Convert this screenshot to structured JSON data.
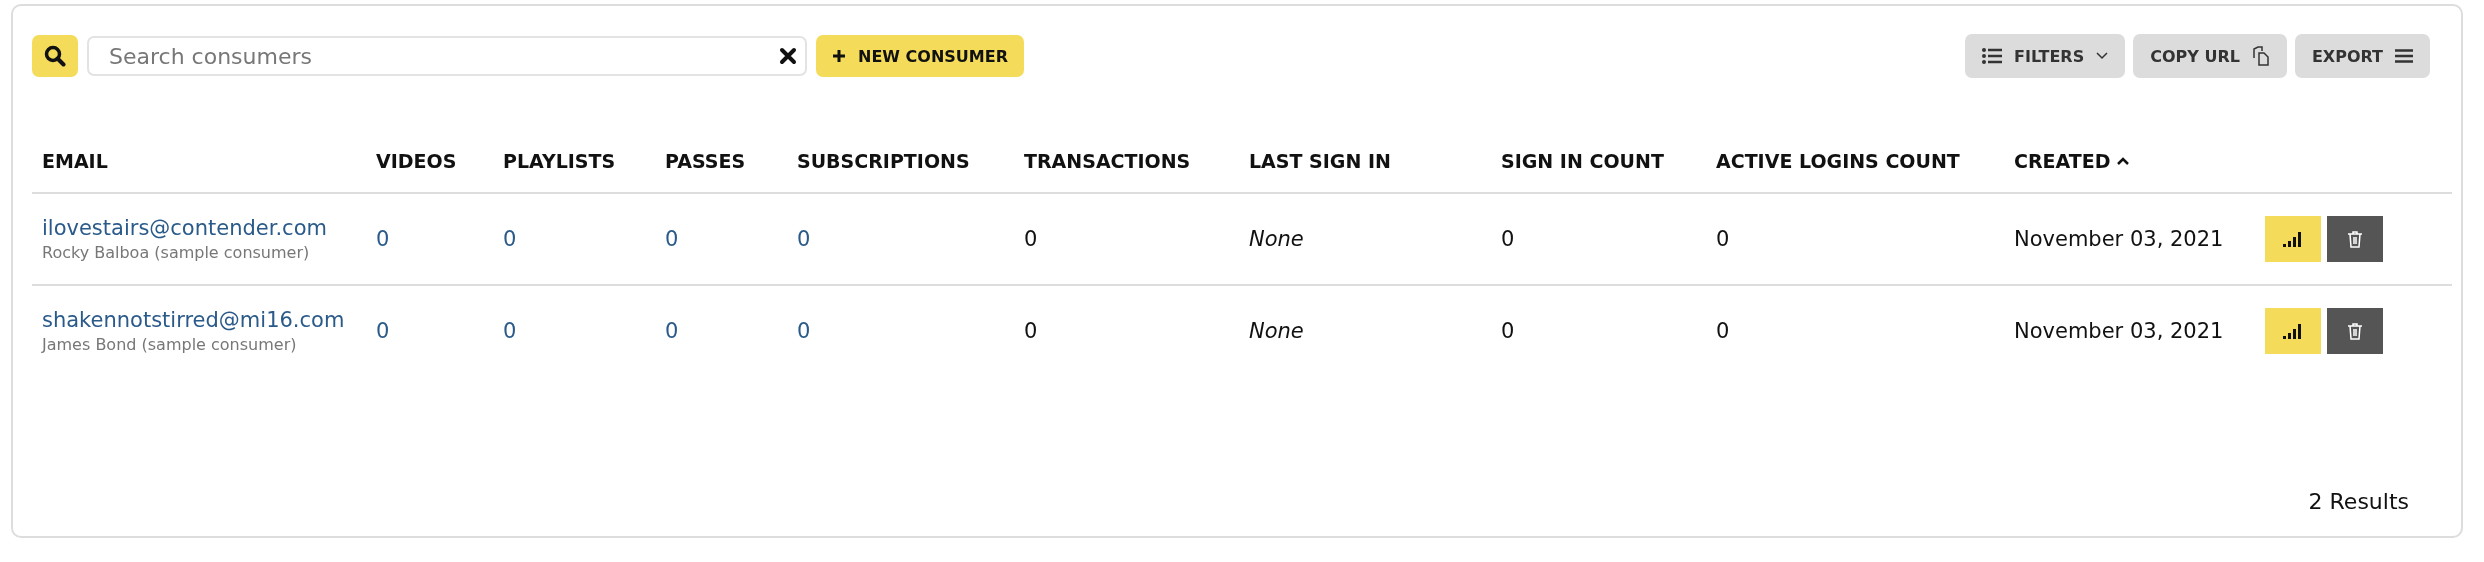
{
  "toolbar": {
    "search": {
      "placeholder": "Search consumers"
    },
    "new_button": "NEW CONSUMER",
    "filters_button": "FILTERS",
    "copy_url_button": "COPY URL",
    "export_button": "EXPORT"
  },
  "table": {
    "columns": [
      {
        "label": "EMAIL",
        "sorted": false
      },
      {
        "label": "VIDEOS",
        "sorted": false
      },
      {
        "label": "PLAYLISTS",
        "sorted": false
      },
      {
        "label": "PASSES",
        "sorted": false
      },
      {
        "label": "SUBSCRIPTIONS",
        "sorted": false
      },
      {
        "label": "TRANSACTIONS",
        "sorted": false
      },
      {
        "label": "LAST SIGN IN",
        "sorted": false
      },
      {
        "label": "SIGN IN COUNT",
        "sorted": false
      },
      {
        "label": "ACTIVE LOGINS COUNT",
        "sorted": false
      },
      {
        "label": "CREATED",
        "sorted": true
      }
    ],
    "rows": [
      {
        "email": "ilovestairs@contender.com",
        "name": "Rocky Balboa (sample consumer)",
        "videos": "0",
        "playlists": "0",
        "passes": "0",
        "subscriptions": "0",
        "transactions": "0",
        "last_sign_in": "None",
        "sign_in_count": "0",
        "active_logins_count": "0",
        "created": "November 03, 2021"
      },
      {
        "email": "shakennotstirred@mi16.com",
        "name": "James Bond (sample consumer)",
        "videos": "0",
        "playlists": "0",
        "passes": "0",
        "subscriptions": "0",
        "transactions": "0",
        "last_sign_in": "None",
        "sign_in_count": "0",
        "active_logins_count": "0",
        "created": "November 03, 2021"
      }
    ]
  },
  "results": "2 Results"
}
